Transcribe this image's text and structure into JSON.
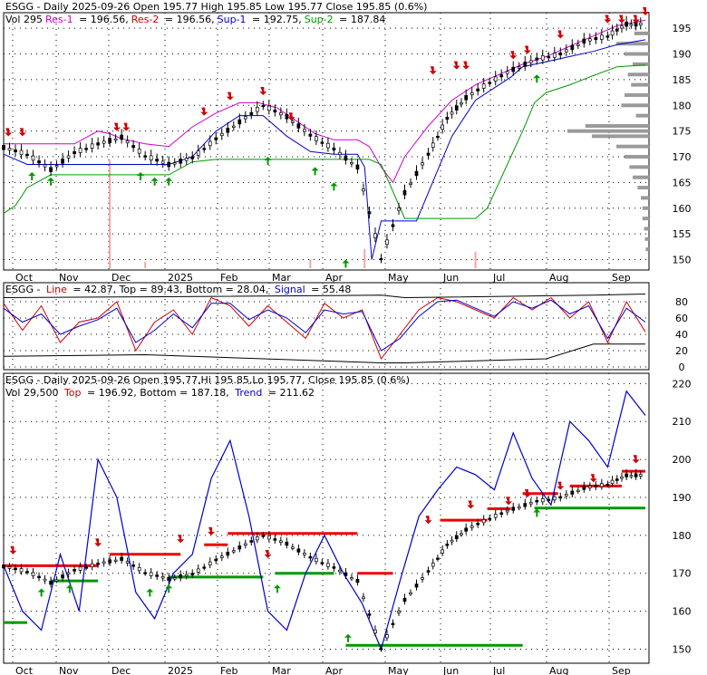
{
  "chart_data": [
    {
      "type": "line",
      "panel": "price",
      "symbol": "ESGG",
      "header_line1": "ESGG - Daily 2025-09-26 Open 195.77  High 195.85  Low 195.77  Close 195.85 (0.6%)",
      "header_line2": [
        {
          "text": "Vol 295",
          "color": "#000000"
        },
        {
          "text": "Res-1",
          "color": "#cc00cc"
        },
        {
          "text": " = 196.56,",
          "color": "#000000"
        },
        {
          "text": "Res-2",
          "color": "#cc0000"
        },
        {
          "text": " = 196.56,",
          "color": "#000000"
        },
        {
          "text": "Sup-1",
          "color": "#0000cc"
        },
        {
          "text": " = 192.75,",
          "color": "#000000"
        },
        {
          "text": "Sup-2",
          "color": "#009900"
        },
        {
          "text": " = 187.84",
          "color": "#000000"
        }
      ],
      "x_labels": [
        "Oct",
        "Nov",
        "Dec",
        "2025",
        "Feb",
        "Mar",
        "Apr",
        "May",
        "Jun",
        "Jul",
        "Aug",
        "Sep"
      ],
      "y_ticks": [
        150,
        155,
        160,
        165,
        170,
        175,
        180,
        185,
        190,
        195
      ],
      "ylim": [
        148.5,
        197.5
      ],
      "grid": true,
      "series": [
        {
          "key": "close",
          "color": "#000000",
          "x": [
            0,
            10,
            20,
            30,
            40,
            50,
            60,
            70,
            80,
            90,
            100,
            110,
            120,
            130,
            140,
            150,
            160,
            170,
            180,
            188,
            196,
            206,
            216,
            226,
            236,
            246,
            256,
            264,
            272
          ],
          "values": [
            171.8,
            170.5,
            167.5,
            170.8,
            172.5,
            173.8,
            170.2,
            168.5,
            169.8,
            173.5,
            176.8,
            180.0,
            177.8,
            174.2,
            171.5,
            168.0,
            150.2,
            163.0,
            170.5,
            177.5,
            181.5,
            184.5,
            187.0,
            189.0,
            190.0,
            192.5,
            193.5,
            195.8,
            195.85
          ]
        },
        {
          "key": "resistance1",
          "color": "#cc00cc",
          "x": [
            0,
            10,
            20,
            30,
            40,
            45,
            50,
            60,
            70,
            80,
            90,
            100,
            108,
            116,
            124,
            132,
            140,
            150,
            155,
            160,
            165,
            170,
            180,
            190,
            200,
            210,
            220,
            230,
            240,
            250,
            260,
            272
          ],
          "values": [
            172.5,
            172.5,
            172.5,
            172.5,
            175.0,
            174.5,
            173.5,
            172.5,
            172.0,
            175.8,
            178.5,
            180.5,
            180.5,
            179.5,
            177.0,
            174.5,
            173.3,
            173.3,
            172.0,
            168.0,
            165.0,
            170.0,
            176.0,
            181.0,
            184.0,
            186.0,
            188.0,
            189.5,
            191.5,
            193.5,
            195.5,
            196.56
          ]
        },
        {
          "key": "support1",
          "color": "#0000cc",
          "x": [
            0,
            10,
            20,
            30,
            40,
            50,
            60,
            70,
            80,
            90,
            100,
            110,
            120,
            130,
            140,
            150,
            153,
            156,
            160,
            165,
            170,
            175,
            180,
            190,
            200,
            210,
            215,
            220,
            230,
            240,
            250,
            260,
            272
          ],
          "values": [
            170.5,
            168.5,
            168.5,
            168.5,
            168.5,
            168.5,
            168.5,
            168.5,
            170.0,
            175.0,
            178.0,
            178.0,
            174.0,
            171.0,
            170.5,
            170.5,
            168.0,
            150.0,
            157.5,
            157.5,
            157.5,
            157.5,
            163.0,
            174.0,
            181.0,
            184.0,
            185.5,
            187.5,
            188.5,
            189.5,
            190.5,
            191.8,
            192.75
          ]
        },
        {
          "key": "support2",
          "color": "#009900",
          "x": [
            0,
            5,
            10,
            20,
            30,
            40,
            50,
            60,
            70,
            80,
            90,
            100,
            110,
            120,
            130,
            140,
            150,
            155,
            160,
            170,
            180,
            190,
            195,
            200,
            205,
            210,
            215,
            220,
            225,
            230,
            240,
            250,
            260,
            272
          ],
          "values": [
            159.0,
            160.5,
            164.0,
            166.5,
            166.5,
            166.5,
            166.5,
            166.5,
            166.5,
            169.0,
            169.5,
            169.5,
            169.5,
            169.5,
            169.5,
            169.5,
            169.5,
            169.5,
            168.5,
            158.0,
            158.0,
            158.0,
            158.0,
            158.0,
            160.0,
            165.0,
            170.0,
            175.0,
            180.5,
            182.5,
            184.0,
            185.8,
            187.5,
            187.84
          ]
        }
      ],
      "volume_bars": [
        {
          "x": 45,
          "value": 0.85
        },
        {
          "x": 153,
          "value": 0.15
        },
        {
          "x": 200,
          "value": 0.13
        },
        {
          "x": 130,
          "value": 0.07
        },
        {
          "x": 60,
          "value": 0.05
        }
      ],
      "volume_profile_note": "Horizontal gray volume-by-price bars at the right edge, tallest near 175."
    },
    {
      "type": "line",
      "panel": "oscillator",
      "header": [
        {
          "text": "ESGG - ",
          "color": "#000000"
        },
        {
          "text": "Line",
          "color": "#cc0000"
        },
        {
          "text": " = 42.87,  Top = 89.43,  Bottom = 28.04, ",
          "color": "#000000"
        },
        {
          "text": "Signal",
          "color": "#0000cc"
        },
        {
          "text": " = 55.48",
          "color": "#000000"
        }
      ],
      "y_ticks": [
        0,
        20,
        40,
        60,
        80
      ],
      "ylim": [
        0,
        100
      ],
      "grid": true,
      "series": [
        {
          "key": "line",
          "color": "#cc0000",
          "x": [
            0,
            8,
            16,
            24,
            32,
            40,
            48,
            56,
            64,
            72,
            80,
            88,
            96,
            104,
            112,
            120,
            128,
            136,
            144,
            152,
            160,
            168,
            176,
            184,
            192,
            200,
            208,
            216,
            224,
            232,
            240,
            248,
            256,
            264,
            272
          ],
          "values": [
            78,
            45,
            75,
            30,
            55,
            60,
            80,
            20,
            55,
            70,
            40,
            85,
            75,
            50,
            75,
            55,
            35,
            78,
            60,
            70,
            10,
            40,
            70,
            85,
            80,
            70,
            60,
            85,
            70,
            85,
            60,
            80,
            30,
            80,
            43
          ]
        },
        {
          "key": "signal",
          "color": "#0000cc",
          "x": [
            0,
            8,
            16,
            24,
            32,
            40,
            48,
            56,
            64,
            72,
            80,
            88,
            96,
            104,
            112,
            120,
            128,
            136,
            144,
            152,
            160,
            168,
            176,
            184,
            192,
            200,
            208,
            216,
            224,
            232,
            240,
            248,
            256,
            264,
            272
          ],
          "values": [
            72,
            55,
            65,
            40,
            50,
            58,
            72,
            30,
            45,
            65,
            48,
            78,
            78,
            58,
            70,
            60,
            42,
            70,
            65,
            68,
            20,
            35,
            62,
            80,
            82,
            72,
            62,
            80,
            72,
            82,
            65,
            75,
            35,
            72,
            55
          ]
        },
        {
          "key": "top",
          "color": "#000000",
          "x": [
            0,
            60,
            160,
            170,
            250,
            272
          ],
          "values": [
            85,
            86,
            88,
            85,
            88,
            89.43
          ]
        },
        {
          "key": "bottom",
          "color": "#000000",
          "x": [
            0,
            60,
            160,
            170,
            230,
            250,
            272
          ],
          "values": [
            13,
            15,
            5,
            5,
            10,
            28,
            28.04
          ]
        }
      ]
    },
    {
      "type": "line",
      "panel": "trend",
      "header_line1": "ESGG - Daily 2025-09-26 Open 195.77,Hi 195.85,Lo 195.77,  Close 195.85 (0.6%)",
      "header_line2": [
        {
          "text": "Vol 29,500  ",
          "color": "#000000"
        },
        {
          "text": "Top",
          "color": "#cc0000"
        },
        {
          "text": " = 196.92,  Bottom = 187.18,  ",
          "color": "#000000"
        },
        {
          "text": "Trend",
          "color": "#0000cc"
        },
        {
          "text": " = 211.62",
          "color": "#000000"
        }
      ],
      "x_labels": [
        "Oct",
        "Nov",
        "Dec",
        "2025",
        "Feb",
        "Mar",
        "Apr",
        "May",
        "Jun",
        "Jul",
        "Aug",
        "Sep"
      ],
      "y_ticks": [
        150,
        160,
        170,
        180,
        190,
        200,
        210,
        220
      ],
      "ylim": [
        147,
        222
      ],
      "grid": true,
      "series": [
        {
          "key": "close",
          "color": "#000000",
          "x": [
            0,
            10,
            20,
            30,
            40,
            50,
            60,
            70,
            80,
            90,
            100,
            110,
            120,
            130,
            140,
            150,
            160,
            170,
            180,
            188,
            196,
            206,
            216,
            226,
            236,
            246,
            256,
            264,
            272
          ],
          "values": [
            171.8,
            170.5,
            167.5,
            170.8,
            172.5,
            173.8,
            170.2,
            168.5,
            169.8,
            173.5,
            176.8,
            180.0,
            177.8,
            174.2,
            171.5,
            168.0,
            150.2,
            163.0,
            170.5,
            177.5,
            181.5,
            184.5,
            187.0,
            189.0,
            190.0,
            192.5,
            193.5,
            195.8,
            195.85
          ]
        },
        {
          "key": "trend",
          "color": "#0000cc",
          "x": [
            0,
            8,
            16,
            24,
            32,
            40,
            48,
            56,
            64,
            72,
            80,
            88,
            96,
            104,
            112,
            120,
            128,
            136,
            144,
            152,
            160,
            168,
            176,
            184,
            192,
            200,
            208,
            216,
            224,
            232,
            240,
            248,
            256,
            264,
            272
          ],
          "values": [
            172,
            160,
            155,
            175,
            160,
            200,
            190,
            165,
            158,
            170,
            175,
            195,
            205,
            185,
            160,
            155,
            170,
            180,
            170,
            162,
            150,
            168,
            185,
            192,
            198,
            196,
            192,
            207,
            195,
            188,
            210,
            205,
            198,
            218,
            211.62
          ]
        }
      ],
      "levels_top": [
        {
          "x0": 0,
          "x1": 40,
          "y": 172
        },
        {
          "x0": 45,
          "x1": 75,
          "y": 175
        },
        {
          "x0": 85,
          "x1": 95,
          "y": 177.5
        },
        {
          "x0": 95,
          "x1": 150,
          "y": 180.5
        },
        {
          "x0": 150,
          "x1": 165,
          "y": 170
        },
        {
          "x0": 185,
          "x1": 205,
          "y": 184
        },
        {
          "x0": 205,
          "x1": 215,
          "y": 187
        },
        {
          "x0": 220,
          "x1": 235,
          "y": 191
        },
        {
          "x0": 240,
          "x1": 262,
          "y": 193
        },
        {
          "x0": 262,
          "x1": 272,
          "y": 196.9
        }
      ],
      "levels_bottom": [
        {
          "x0": 0,
          "x1": 10,
          "y": 157
        },
        {
          "x0": 20,
          "x1": 40,
          "y": 168
        },
        {
          "x0": 70,
          "x1": 110,
          "y": 169
        },
        {
          "x0": 115,
          "x1": 140,
          "y": 170
        },
        {
          "x0": 145,
          "x1": 220,
          "y": 151
        },
        {
          "x0": 225,
          "x1": 272,
          "y": 187.18
        }
      ]
    }
  ]
}
